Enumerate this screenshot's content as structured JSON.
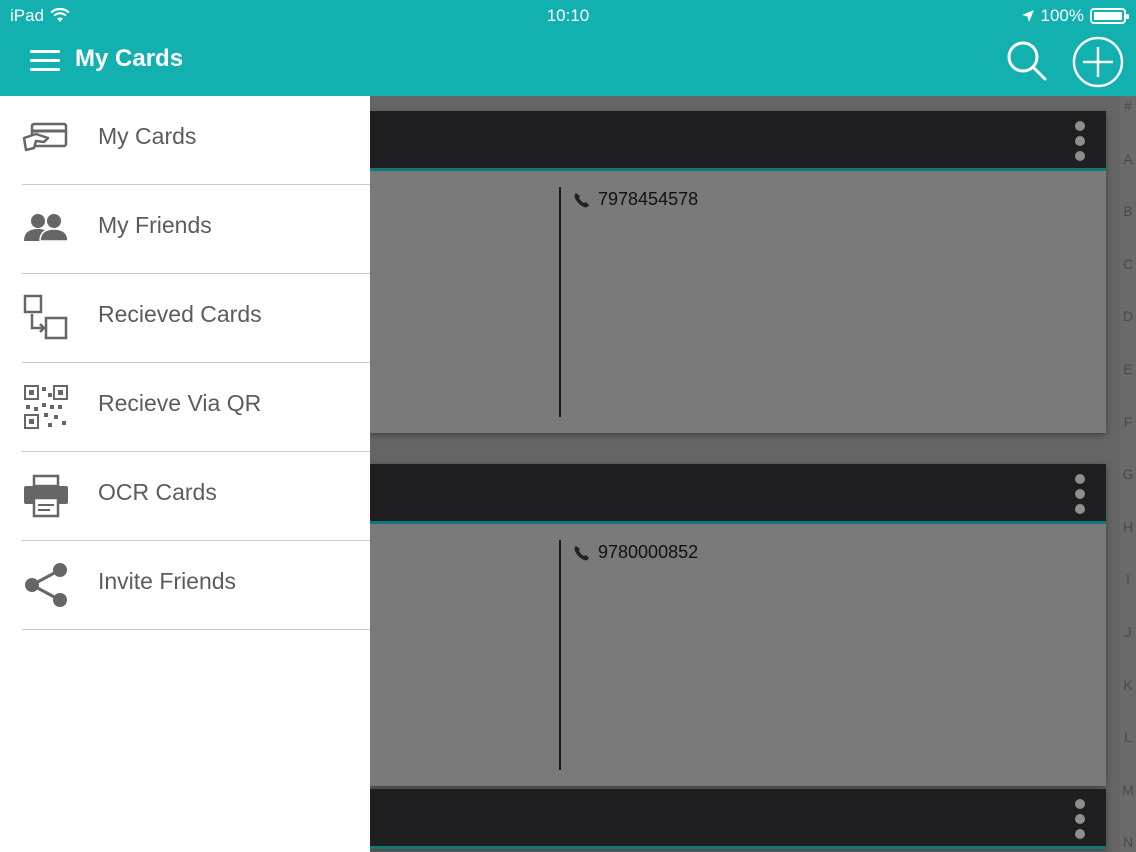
{
  "status_bar": {
    "device": "iPad",
    "time": "10:10",
    "battery": "100%"
  },
  "nav": {
    "title": "My Cards"
  },
  "drawer": {
    "items": [
      {
        "label": "My Cards",
        "icon": "card-hand-icon"
      },
      {
        "label": "My Friends",
        "icon": "friends-icon"
      },
      {
        "label": "Recieved Cards",
        "icon": "received-cards-icon"
      },
      {
        "label": "Recieve Via QR",
        "icon": "qr-code-icon"
      },
      {
        "label": "OCR Cards",
        "icon": "ocr-scanner-icon"
      },
      {
        "label": "Invite Friends",
        "icon": "share-icon"
      }
    ]
  },
  "cards": [
    {
      "phone": "7978454578"
    },
    {
      "phone": "9780000852"
    },
    {
      "phone": ""
    }
  ],
  "alphabet": [
    "#",
    "A",
    "B",
    "C",
    "D",
    "E",
    "F",
    "G",
    "H",
    "I",
    "J",
    "K",
    "L",
    "M",
    "N"
  ],
  "colors": {
    "header": "#12b0ae",
    "card_header": "#1f1f21",
    "accent_line": "#0d7a78"
  }
}
